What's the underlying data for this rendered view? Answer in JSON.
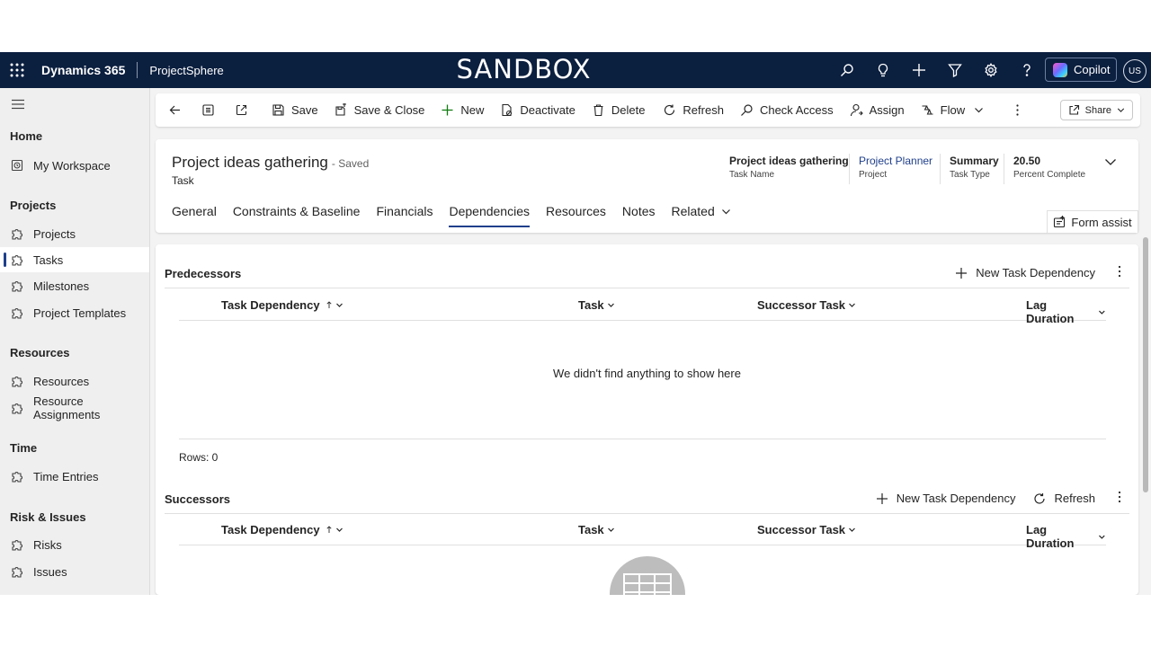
{
  "app": {
    "brand": "Dynamics 365",
    "app_name": "ProjectSphere",
    "environment_banner": "SANDBOX",
    "header_icons": [
      "search-icon",
      "lightbulb-icon",
      "plus-icon",
      "filter-icon",
      "gear-icon",
      "help-icon"
    ],
    "copilot_label": "Copilot",
    "user_initials": "US"
  },
  "sidebar": {
    "groups": [
      {
        "label": "Home",
        "items": [
          {
            "label": "My Workspace",
            "icon": "clock-icon"
          }
        ]
      },
      {
        "label": "Projects",
        "items": [
          {
            "label": "Projects",
            "icon": "puzzle-icon"
          },
          {
            "label": "Tasks",
            "icon": "puzzle-icon",
            "selected": true
          },
          {
            "label": "Milestones",
            "icon": "puzzle-icon"
          },
          {
            "label": "Project Templates",
            "icon": "puzzle-icon"
          }
        ]
      },
      {
        "label": "Resources",
        "items": [
          {
            "label": "Resources",
            "icon": "puzzle-icon"
          },
          {
            "label": "Resource Assignments",
            "icon": "puzzle-icon"
          }
        ]
      },
      {
        "label": "Time",
        "items": [
          {
            "label": "Time Entries",
            "icon": "puzzle-icon"
          }
        ]
      },
      {
        "label": "Risk & Issues",
        "items": [
          {
            "label": "Risks",
            "icon": "puzzle-icon"
          },
          {
            "label": "Issues",
            "icon": "puzzle-icon"
          }
        ]
      }
    ]
  },
  "commandbar": {
    "save": "Save",
    "save_close": "Save & Close",
    "new": "New",
    "deactivate": "Deactivate",
    "delete": "Delete",
    "refresh": "Refresh",
    "check_access": "Check Access",
    "assign": "Assign",
    "flow": "Flow",
    "share": "Share"
  },
  "record": {
    "title": "Project ideas gathering",
    "save_status": "- Saved",
    "entity": "Task",
    "header_fields": [
      {
        "value": "Project ideas gathering",
        "label": "Task Name"
      },
      {
        "value": "Project Planner",
        "label": "Project"
      },
      {
        "value": "Summary",
        "label": "Task Type"
      },
      {
        "value": "20.50",
        "label": "Percent Complete"
      }
    ],
    "tabs": [
      "General",
      "Constraints & Baseline",
      "Financials",
      "Dependencies",
      "Resources",
      "Notes",
      "Related"
    ],
    "active_tab": "Dependencies",
    "form_assist": "Form assist"
  },
  "predecessors": {
    "title": "Predecessors",
    "new_label": "New Task Dependency",
    "columns": [
      "Task Dependency",
      "Task",
      "Successor Task",
      "Lag Duration"
    ],
    "empty_message": "We didn't find anything to show here",
    "rows_label": "Rows: 0"
  },
  "successors": {
    "title": "Successors",
    "new_label": "New Task Dependency",
    "refresh_label": "Refresh",
    "columns": [
      "Task Dependency",
      "Task",
      "Successor Task",
      "Lag Duration"
    ]
  }
}
